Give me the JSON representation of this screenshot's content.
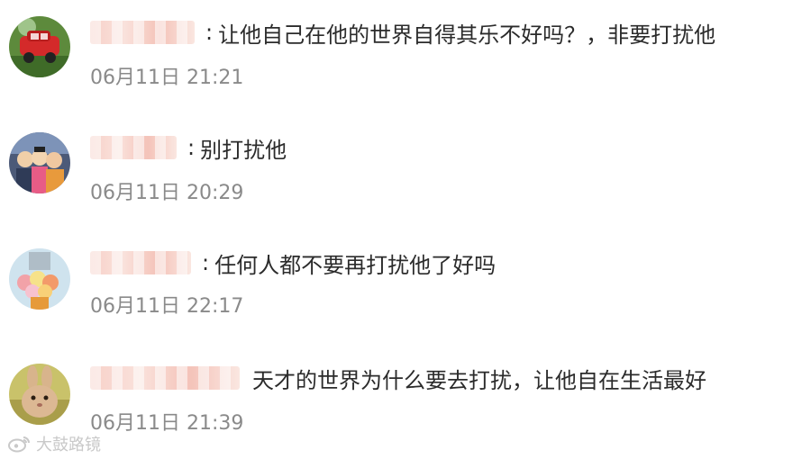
{
  "comments": [
    {
      "text": "让他自己在他的世界自得其乐不好吗？，非要打扰他",
      "time": "06月11日 21:21",
      "avatar_icon": "red-car-avatar"
    },
    {
      "text": "别打扰他",
      "time": "06月11日 20:29",
      "avatar_icon": "group-photo-avatar"
    },
    {
      "text": "任何人都不要再打扰他了好吗",
      "time": "06月11日 22:17",
      "avatar_icon": "flowers-avatar"
    },
    {
      "text": "天才的世界为什么要去打扰，让他自在生活最好",
      "time": "06月11日 21:39",
      "avatar_icon": "rabbit-avatar"
    }
  ],
  "watermark": {
    "text": "大鼓路镜",
    "icon": "weibo-logo-icon"
  },
  "colors": {
    "text": "#2b2b2b",
    "time": "#8a8a8a",
    "blur": "#f6c9bf"
  }
}
